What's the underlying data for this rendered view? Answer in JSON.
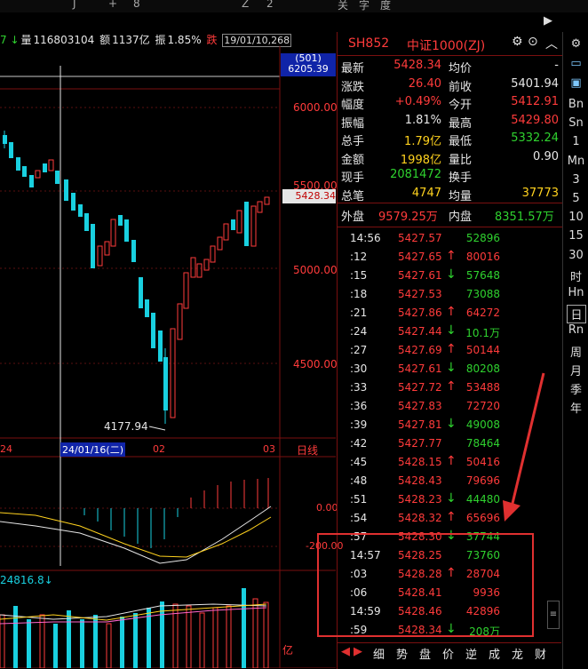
{
  "header": {
    "arrow": "7 ↓",
    "vol_label": "量",
    "vol_value": "116803104",
    "amt_label": "额",
    "amt_value": "1137亿",
    "amp_label": "振",
    "amp_value": "1.85%",
    "chg_label": "跌",
    "date_box": "19/01/10,268"
  },
  "price_axis": {
    "ticks": [
      "6000.00",
      "5500.00",
      "5000.00",
      "4500.00"
    ],
    "current": "5428.34",
    "top_box_a": "(501)",
    "top_box_b": "6205.39"
  },
  "annotations": {
    "low": "4177.94",
    "cursor_date": "24/01/16(二)",
    "x_left": "24",
    "x_mid": "02",
    "x_right": "03",
    "period": "日线"
  },
  "macd_axis": {
    "zero": "0.00",
    "neg": "-200.00"
  },
  "vol_panel": {
    "value": "24816.8↓",
    "unit": "亿"
  },
  "quote": {
    "code": "SH852",
    "name": "中证1000(ZJ)",
    "rows": [
      {
        "l1": "最新",
        "v1": "5428.34",
        "c1": "red",
        "l2": "均价",
        "v2": "-",
        "c2": "white"
      },
      {
        "l1": "涨跌",
        "v1": "26.40",
        "c1": "red",
        "l2": "前收",
        "v2": "5401.94",
        "c2": "white"
      },
      {
        "l1": "幅度",
        "v1": "+0.49%",
        "c1": "red",
        "l2": "今开",
        "v2": "5412.91",
        "c2": "red"
      },
      {
        "l1": "振幅",
        "v1": "1.81%",
        "c1": "white",
        "l2": "最高",
        "v2": "5429.80",
        "c2": "red"
      },
      {
        "l1": "总手",
        "v1": "1.79亿",
        "c1": "yellow",
        "l2": "最低",
        "v2": "5332.24",
        "c2": "green"
      },
      {
        "l1": "金额",
        "v1": "1998亿",
        "c1": "yellow",
        "l2": "量比",
        "v2": "0.90",
        "c2": "white"
      },
      {
        "l1": "现手",
        "v1": "2081472",
        "c1": "green",
        "l2": "换手",
        "v2": "",
        "c2": "white"
      },
      {
        "l1": "总笔",
        "v1": "4747",
        "c1": "yellow",
        "l2": "均量",
        "v2": "37773",
        "c2": "yellow"
      }
    ],
    "outer_label": "外盘",
    "outer_value": "9579.25万",
    "inner_label": "内盘",
    "inner_value": "8351.57万"
  },
  "ticks": [
    {
      "t": "14:56",
      "p": "5427.57",
      "a": "",
      "v": "52896",
      "vc": "green"
    },
    {
      "t": ":12",
      "p": "5427.65",
      "a": "↑",
      "v": "80016",
      "vc": "red"
    },
    {
      "t": ":15",
      "p": "5427.61",
      "a": "↓",
      "v": "57648",
      "vc": "green"
    },
    {
      "t": ":18",
      "p": "5427.53",
      "a": "",
      "v": "73088",
      "vc": "green"
    },
    {
      "t": ":21",
      "p": "5427.86",
      "a": "↑",
      "v": "64272",
      "vc": "red"
    },
    {
      "t": ":24",
      "p": "5427.44",
      "a": "↓",
      "v": "10.1万",
      "vc": "green"
    },
    {
      "t": ":27",
      "p": "5427.69",
      "a": "↑",
      "v": "50144",
      "vc": "red"
    },
    {
      "t": ":30",
      "p": "5427.61",
      "a": "↓",
      "v": "80208",
      "vc": "green"
    },
    {
      "t": ":33",
      "p": "5427.72",
      "a": "↑",
      "v": "53488",
      "vc": "red"
    },
    {
      "t": ":36",
      "p": "5427.83",
      "a": "",
      "v": "72720",
      "vc": "red"
    },
    {
      "t": ":39",
      "p": "5427.81",
      "a": "↓",
      "v": "49008",
      "vc": "green"
    },
    {
      "t": ":42",
      "p": "5427.77",
      "a": "",
      "v": "78464",
      "vc": "green"
    },
    {
      "t": ":45",
      "p": "5428.15",
      "a": "↑",
      "v": "50416",
      "vc": "red"
    },
    {
      "t": ":48",
      "p": "5428.43",
      "a": "",
      "v": "79696",
      "vc": "red"
    },
    {
      "t": ":51",
      "p": "5428.23",
      "a": "↓",
      "v": "44480",
      "vc": "green"
    },
    {
      "t": ":54",
      "p": "5428.32",
      "a": "↑",
      "v": "65696",
      "vc": "red"
    },
    {
      "t": ":57",
      "p": "5428.30",
      "a": "↓",
      "v": "37744",
      "vc": "green"
    },
    {
      "t": "14:57",
      "p": "5428.25",
      "a": "",
      "v": "73760",
      "vc": "green"
    },
    {
      "t": ":03",
      "p": "5428.28",
      "a": "↑",
      "v": "28704",
      "vc": "red"
    },
    {
      "t": ":06",
      "p": "5428.41",
      "a": "",
      "v": "9936",
      "vc": "red"
    },
    {
      "t": "14:59",
      "p": "5428.46",
      "a": "",
      "v": "42896",
      "vc": "red"
    },
    {
      "t": ":59",
      "p": "5428.34",
      "a": "↓",
      "v": "208万",
      "vc": "green"
    }
  ],
  "tabs": [
    "细",
    "势",
    "盘",
    "价",
    "逆",
    "成",
    "龙",
    "财"
  ],
  "toolbar": [
    "Bn",
    "Sn",
    "1",
    "Mn",
    "3",
    "5",
    "10",
    "15",
    "30",
    "时",
    "Hn",
    "日",
    "Rn",
    "周",
    "月",
    "季",
    "年"
  ],
  "topbar": [
    "J",
    "+",
    "8",
    "Z",
    "2",
    "关",
    "字",
    "度"
  ]
}
